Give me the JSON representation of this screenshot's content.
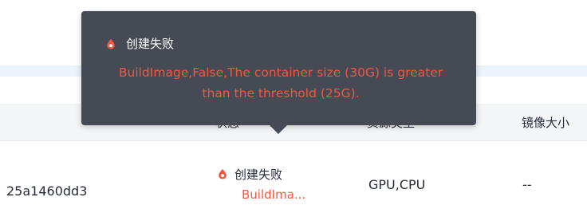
{
  "table": {
    "headers": {
      "status": "状态",
      "resource_type": "资源类型",
      "image_size": "镜像大小"
    },
    "row": {
      "id_fragment": "25a1460dd3",
      "status": "创建失败",
      "status_detail": "BuildIma...",
      "resource_type": "GPU,CPU",
      "image_size": "--"
    }
  },
  "tooltip": {
    "title": "创建失败",
    "message": "BuildImage,False,The container size (30G) is greater than the threshold (25G)."
  },
  "colors": {
    "error": "#f4573d",
    "tooltip_bg": "#464a55",
    "header_bg": "#f4f5f7",
    "band": "#edf3fb"
  },
  "icons": {
    "status": "error-drop-icon",
    "tooltip": "error-drop-icon"
  }
}
